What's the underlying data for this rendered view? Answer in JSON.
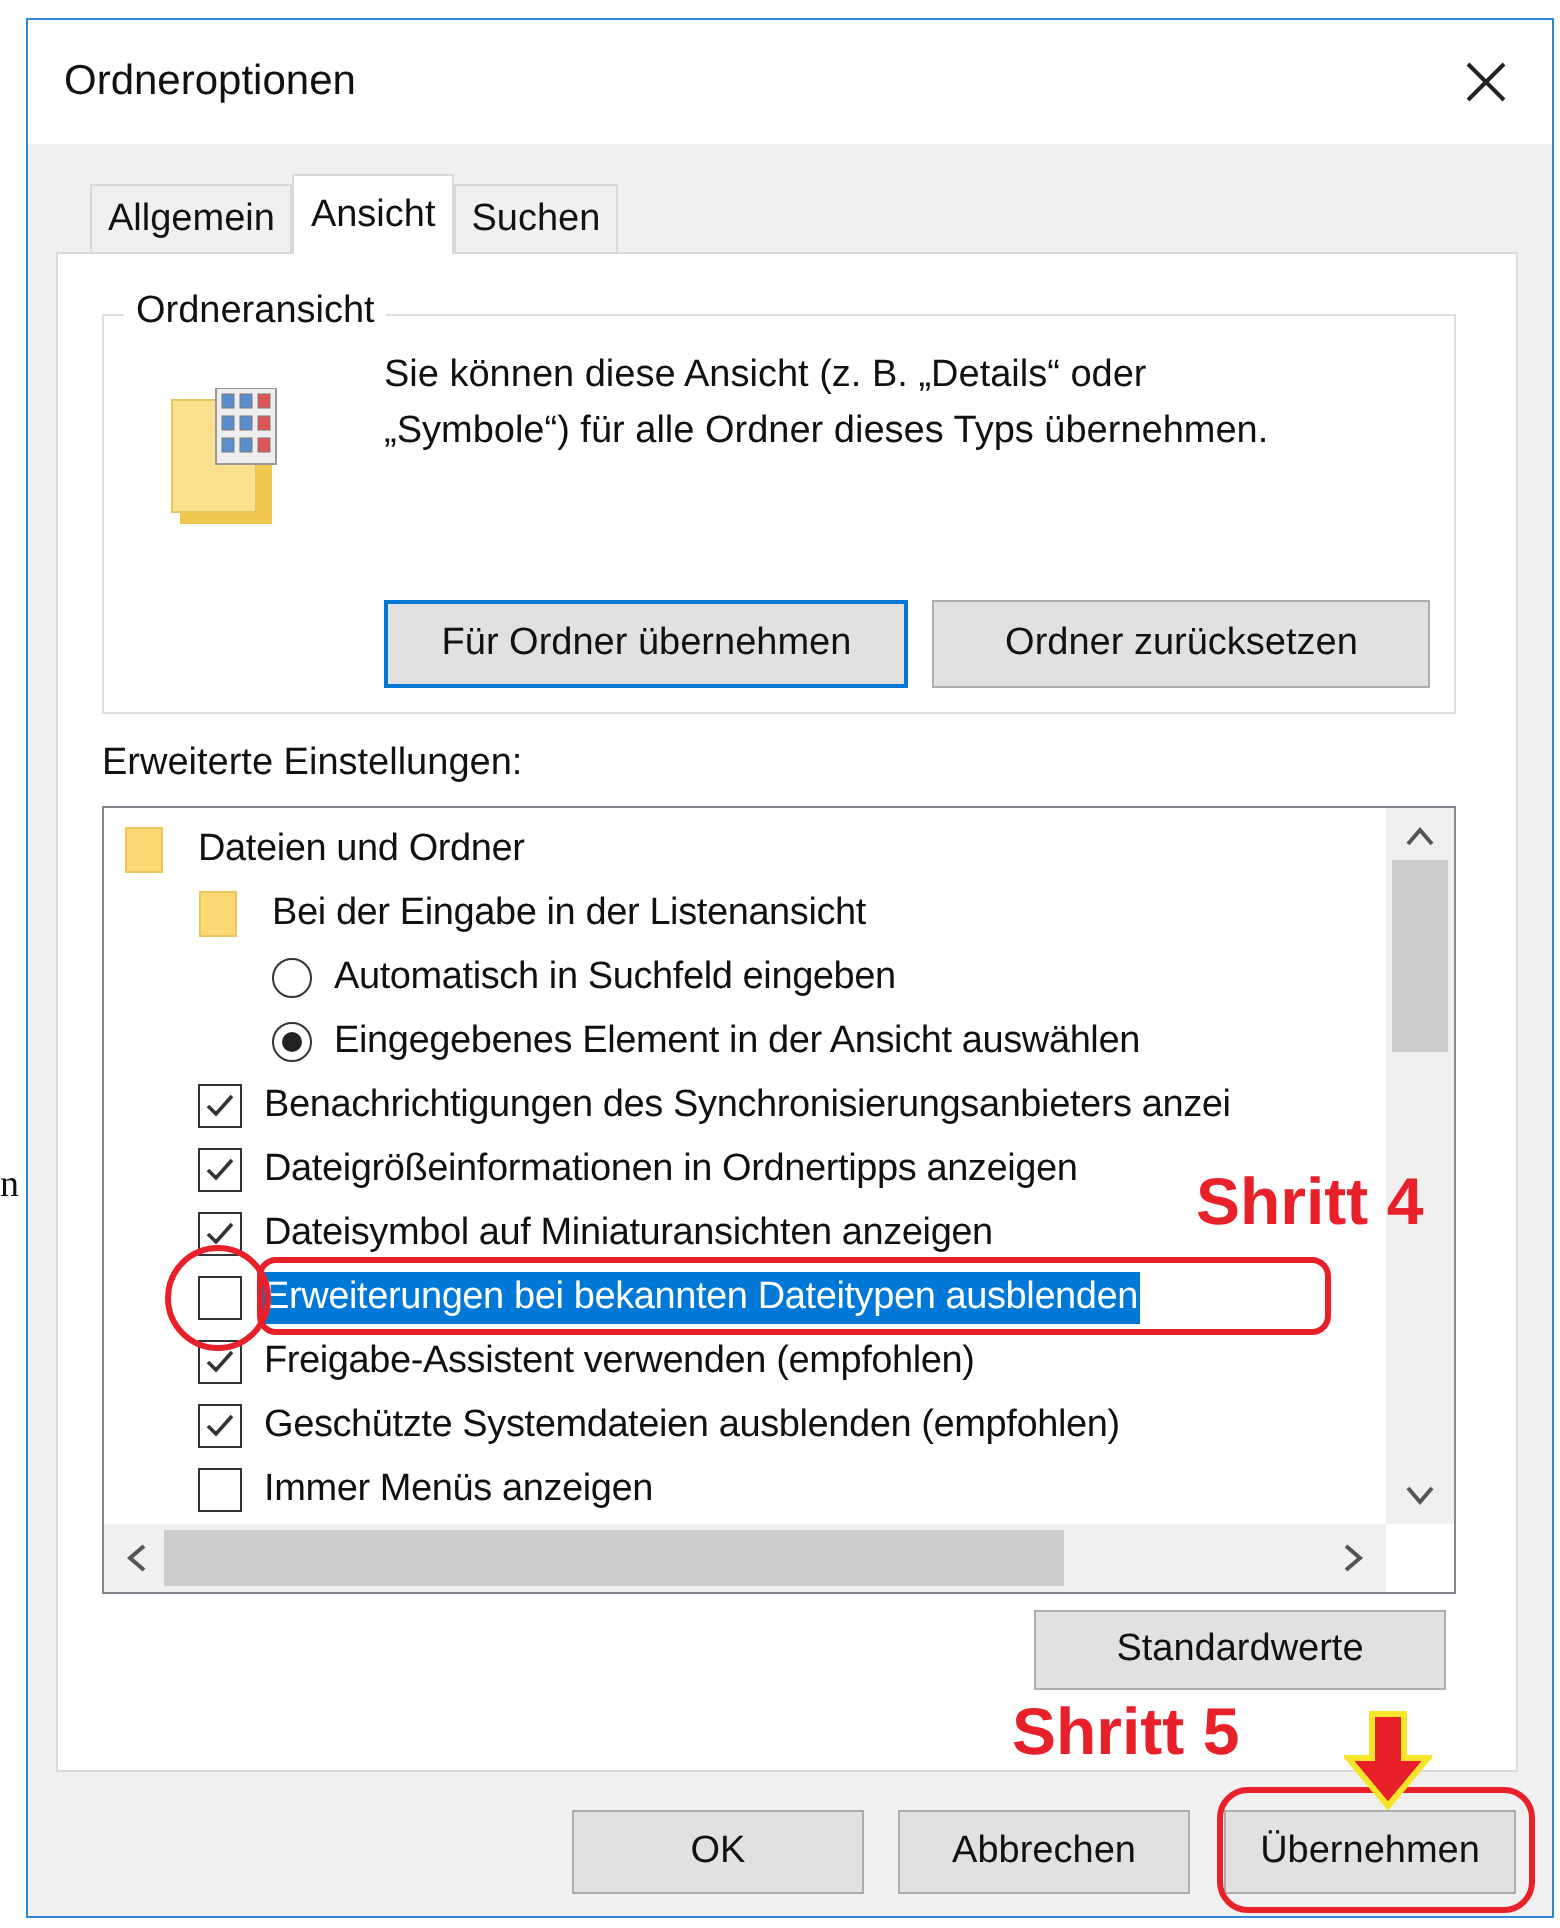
{
  "background_text": "n",
  "window": {
    "title": "Ordneroptionen"
  },
  "tabs": [
    {
      "label": "Allgemein",
      "selected": false
    },
    {
      "label": "Ansicht",
      "selected": true
    },
    {
      "label": "Suchen",
      "selected": false
    }
  ],
  "folder_view": {
    "title": "Ordneransicht",
    "description_lines": [
      "Sie können diese Ansicht (z. B. „Details“ oder",
      "„Symbole“) für alle Ordner dieses Typs übernehmen."
    ],
    "buttons": [
      {
        "label": "Für Ordner übernehmen",
        "focused": true
      },
      {
        "label": "Ordner zurücksetzen",
        "focused": false
      }
    ]
  },
  "advanced": {
    "label": "Erweiterte Einstellungen:",
    "items": [
      {
        "kind": "folder",
        "label": "Dateien und Ordner",
        "selected": false,
        "children": [
          {
            "kind": "folder",
            "label": "Bei der Eingabe in der Listenansicht",
            "selected": false,
            "children": [
              {
                "kind": "radio",
                "label": "Automatisch in Suchfeld eingeben",
                "checked": false,
                "selected": false
              },
              {
                "kind": "radio",
                "label": "Eingegebenes Element in der Ansicht auswählen",
                "checked": true,
                "selected": false
              }
            ]
          },
          {
            "kind": "checkbox",
            "label": "Benachrichtigungen des Synchronisierungsanbieters anzei",
            "checked": true,
            "selected": false
          },
          {
            "kind": "checkbox",
            "label": "Dateigrößeinformationen in Ordnertipps anzeigen",
            "checked": true,
            "selected": false
          },
          {
            "kind": "checkbox",
            "label": "Dateisymbol auf Miniaturansichten anzeigen",
            "checked": true,
            "selected": false
          },
          {
            "kind": "checkbox",
            "label": "Erweiterungen bei bekannten Dateitypen ausblenden",
            "checked": false,
            "selected": true
          },
          {
            "kind": "checkbox",
            "label": "Freigabe-Assistent verwenden (empfohlen)",
            "checked": true,
            "selected": false
          },
          {
            "kind": "checkbox",
            "label": "Geschützte Systemdateien ausblenden (empfohlen)",
            "checked": true,
            "selected": false
          },
          {
            "kind": "checkbox",
            "label": "Immer Menüs anzeigen",
            "checked": false,
            "selected": false
          }
        ]
      }
    ]
  },
  "defaults_button": "Standardwerte",
  "dialog_buttons": [
    "OK",
    "Abbrechen",
    "Übernehmen"
  ],
  "annotations": [
    {
      "text": "Shritt 4"
    },
    {
      "text": "Shritt 5"
    }
  ]
}
